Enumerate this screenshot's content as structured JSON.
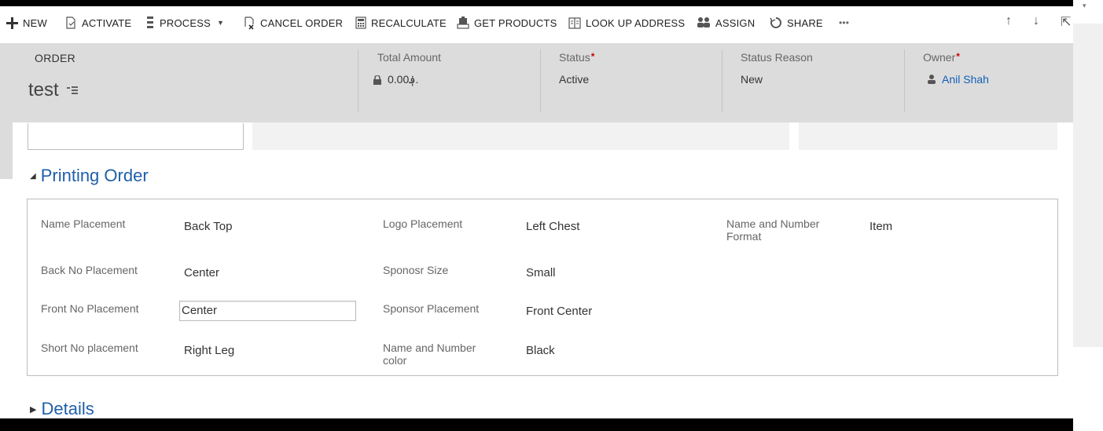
{
  "toolbar": {
    "new": "NEW",
    "activate": "ACTIVATE",
    "process": "PROCESS",
    "cancel_order": "CANCEL ORDER",
    "recalculate": "RECALCULATE",
    "get_products": "GET PRODUCTS",
    "look_up_address": "LOOK UP ADDRESS",
    "assign": "ASSIGN",
    "share": "SHARE",
    "more": "•••"
  },
  "header": {
    "entity_type": "ORDER",
    "record_name": "test",
    "total_amount_label": "Total Amount",
    "total_amount_value": "0.00؋.",
    "status_label": "Status",
    "status_value": "Active",
    "status_reason_label": "Status Reason",
    "status_reason_value": "New",
    "owner_label": "Owner",
    "owner_value": "Anil Shah",
    "required_mark": "*"
  },
  "section": {
    "title": "Printing Order",
    "fields": {
      "name_placement": {
        "label": "Name Placement",
        "value": "Back Top"
      },
      "logo_placement": {
        "label": "Logo Placement",
        "value": "Left Chest"
      },
      "name_number_format": {
        "label": "Name and Number Format",
        "value": "Item"
      },
      "back_no_placement": {
        "label": "Back No Placement",
        "value": "Center"
      },
      "sponosr_size": {
        "label": "Sponosr Size",
        "value": "Small"
      },
      "front_no_placement": {
        "label": "Front No Placement",
        "value": "Center"
      },
      "sponsor_placement": {
        "label": "Sponsor Placement",
        "value": "Front Center"
      },
      "short_no_placement": {
        "label": "Short No placement",
        "value": "Right Leg"
      },
      "name_number_color": {
        "label": "Name and Number color",
        "value": "Black"
      }
    }
  },
  "details": {
    "title": "Details"
  },
  "colors": {
    "accent": "#1f5fa8",
    "link": "#1160b7",
    "header_bg": "#dcdcdc",
    "required": "#cc0000"
  }
}
